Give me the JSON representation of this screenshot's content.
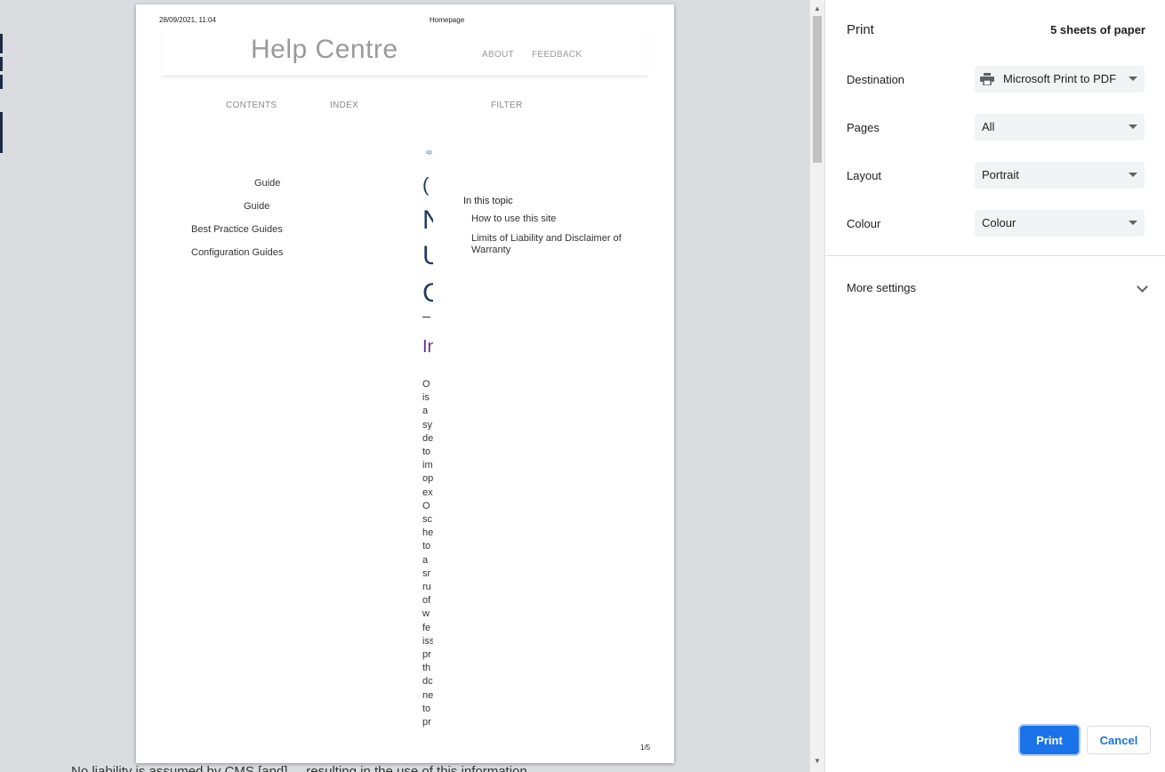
{
  "preview": {
    "header_date": "28/09/2021, 11:04",
    "header_title": "Homepage",
    "site_title": "Help Centre",
    "nav": [
      "ABOUT",
      "FEEDBACK"
    ],
    "subnav": [
      "CONTENTS",
      "INDEX",
      "FILTER"
    ],
    "side_links": [
      "Guide",
      "Guide",
      "Best Practice Guides",
      "Configuration Guides"
    ],
    "crumb": "op",
    "heading_glyphs": [
      "(",
      "N",
      "U",
      "C"
    ],
    "section_glyph": "In",
    "body_lines": [
      "O",
      "is",
      "a",
      "sy",
      "de",
      "to",
      "im",
      "op",
      "ex",
      "O",
      "sc",
      "he",
      "to",
      "a",
      "sr",
      "ru",
      "of",
      "w",
      "fe",
      "iss",
      "pr",
      "th",
      "dc",
      "ne",
      "to",
      "pr"
    ],
    "toc_heading": "In this topic",
    "toc_items": [
      "How to use this site",
      "Limits of Liability and Disclaimer of Warranty"
    ],
    "page_number": "1/5",
    "background_text": "No liability is assumed by CMS [and] ... resulting in the use of this information"
  },
  "panel": {
    "title": "Print",
    "sheets": "5 sheets of paper",
    "destination_label": "Destination",
    "destination_value": "Microsoft Print to PDF",
    "pages_label": "Pages",
    "pages_value": "All",
    "layout_label": "Layout",
    "layout_value": "Portrait",
    "colour_label": "Colour",
    "colour_value": "Colour",
    "more_settings": "More settings",
    "print_button": "Print",
    "cancel_button": "Cancel"
  },
  "colors": {
    "accent": "#1a73e8",
    "preview_bg": "#dadce0",
    "select_bg": "#f1f3f4"
  },
  "icons": {
    "printer": "printer-icon",
    "dropdown": "dropdown-arrow-icon",
    "expand": "chevron-down-icon"
  }
}
